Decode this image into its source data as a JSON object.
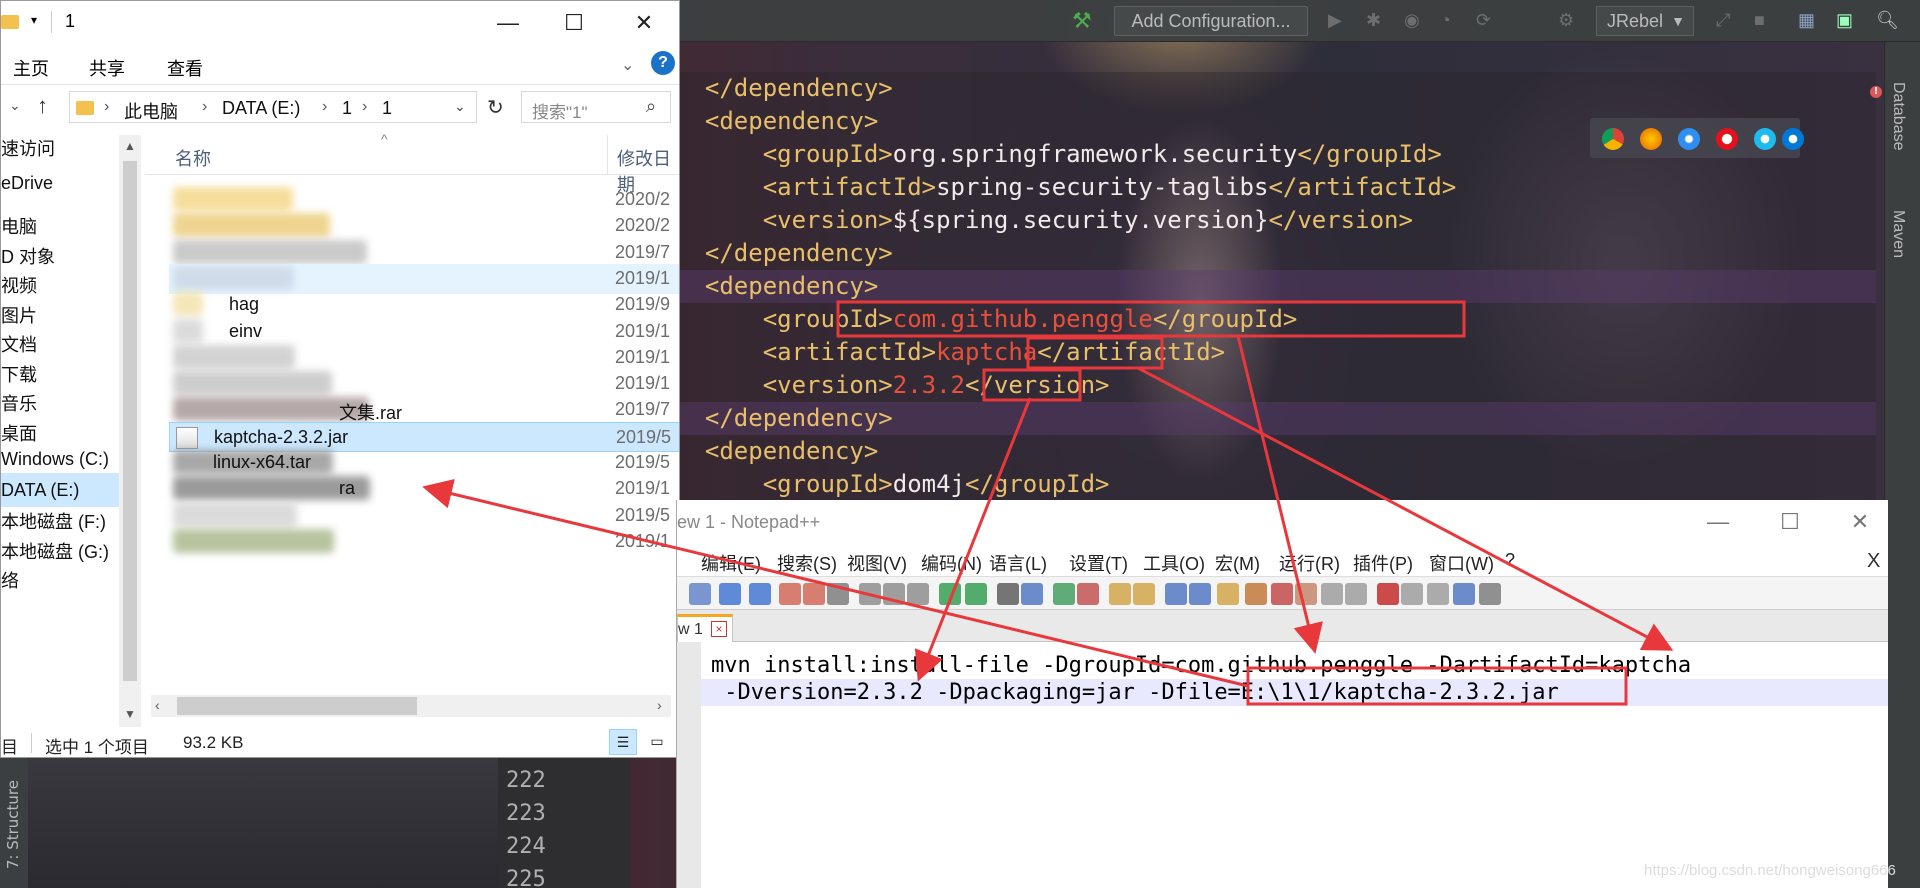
{
  "ide": {
    "add_configuration": "Add Configuration...",
    "jrebel": "JRebel",
    "side_tabs": [
      "Database",
      "Maven"
    ],
    "structure_tab": "7: Structure",
    "line_numbers": [
      "222",
      "223",
      "224",
      "225"
    ],
    "code_lines": [
      {
        "indent": "",
        "parts": [
          [
            "tg",
            "</dependency>"
          ]
        ]
      },
      {
        "indent": "",
        "parts": [
          [
            "tg",
            "<dependency>"
          ]
        ]
      },
      {
        "indent": "    ",
        "parts": [
          [
            "tg",
            "<groupId>"
          ],
          [
            "tx",
            "org.springframework.security"
          ],
          [
            "tg",
            "</groupId>"
          ]
        ]
      },
      {
        "indent": "    ",
        "parts": [
          [
            "tg",
            "<artifactId>"
          ],
          [
            "tx",
            "spring-security-taglibs"
          ],
          [
            "tg",
            "</artifactId>"
          ]
        ]
      },
      {
        "indent": "    ",
        "parts": [
          [
            "tg",
            "<version>"
          ],
          [
            "tx",
            "${spring.security.version}"
          ],
          [
            "tg",
            "</version>"
          ]
        ]
      },
      {
        "indent": "",
        "parts": [
          [
            "tg",
            "</dependency>"
          ]
        ]
      },
      {
        "indent": "",
        "parts": [
          [
            "tg",
            "<dependency>"
          ]
        ]
      },
      {
        "indent": "    ",
        "parts": [
          [
            "tg",
            "<groupId>"
          ],
          [
            "red-t",
            "com.github.penggle"
          ],
          [
            "tg",
            "</groupId>"
          ]
        ]
      },
      {
        "indent": "    ",
        "parts": [
          [
            "tg",
            "<artifactId>"
          ],
          [
            "red-t",
            "kaptcha"
          ],
          [
            "tg",
            "</artifactId>"
          ]
        ]
      },
      {
        "indent": "    ",
        "parts": [
          [
            "tg",
            "<version>"
          ],
          [
            "red-t",
            "2.3.2"
          ],
          [
            "tg",
            "</version>"
          ]
        ]
      },
      {
        "indent": "",
        "parts": [
          [
            "tg",
            "</dependency>"
          ]
        ]
      },
      {
        "indent": "",
        "parts": [
          [
            "tg",
            "<dependency>"
          ]
        ]
      },
      {
        "indent": "    ",
        "parts": [
          [
            "tg",
            "<groupId>"
          ],
          [
            "tx",
            "dom4j"
          ],
          [
            "tg",
            "</groupId>"
          ]
        ]
      }
    ]
  },
  "explorer": {
    "title": "1",
    "ribbon_tabs": [
      "主页",
      "共享",
      "查看"
    ],
    "breadcrumb": [
      "此电脑",
      "DATA (E:)",
      "1",
      "1"
    ],
    "search_placeholder": "搜索\"1\"",
    "columns": {
      "name": "名称",
      "modified": "修改日期"
    },
    "nav_items": [
      "速访问",
      "eDrive",
      "电脑",
      "D 对象",
      "视频",
      "图片",
      "文档",
      "下载",
      "音乐",
      "桌面",
      "Windows (C:)",
      "DATA (E:)",
      "本地磁盘 (F:)",
      "本地磁盘 (G:)",
      "络"
    ],
    "files": [
      {
        "name": "",
        "date": "2020/2"
      },
      {
        "name": "",
        "date": "2020/2"
      },
      {
        "name": "",
        "date": "2019/7"
      },
      {
        "name": "",
        "date": "2019/1"
      },
      {
        "name": "hag",
        "date": "2019/9"
      },
      {
        "name": "einv",
        "date": "2019/1"
      },
      {
        "name": "",
        "date": "2019/1"
      },
      {
        "name": "",
        "date": "2019/1"
      },
      {
        "name": "文集.rar",
        "date": "2019/7"
      },
      {
        "name": "kaptcha-2.3.2.jar",
        "date": "2019/5"
      },
      {
        "name": "linux-x64.tar",
        "date": "2019/5"
      },
      {
        "name": "ra",
        "date": "2019/1"
      },
      {
        "name": "",
        "date": "2019/5"
      },
      {
        "name": "",
        "date": "2019/1"
      }
    ],
    "status": {
      "left": "目",
      "selection": "选中 1 个项目",
      "size": "93.2 KB"
    }
  },
  "notepad": {
    "title": "ew 1 - Notepad++",
    "menu": [
      "编辑(E)",
      "搜索(S)",
      "视图(V)",
      "编码(N)",
      "语言(L)",
      "设置(T)",
      "工具(O)",
      "宏(M)",
      "运行(R)",
      "插件(P)",
      "窗口(W)",
      "?"
    ],
    "close_x": "X",
    "tab_label": "w 1",
    "tab_close": "×",
    "lines": [
      "mvn install:install-file -DgroupId=com.github.penggle -DartifactId=kaptcha",
      " -Dversion=2.3.2 -Dpackaging=jar -Dfile=E:\\1\\1/kaptcha-2.3.2.jar"
    ]
  },
  "watermark": "https://blog.csdn.net/hongweisong666",
  "colors": {
    "annotation": "#e8383c",
    "accent": "#1a73c8",
    "selection": "#cce8ff"
  }
}
